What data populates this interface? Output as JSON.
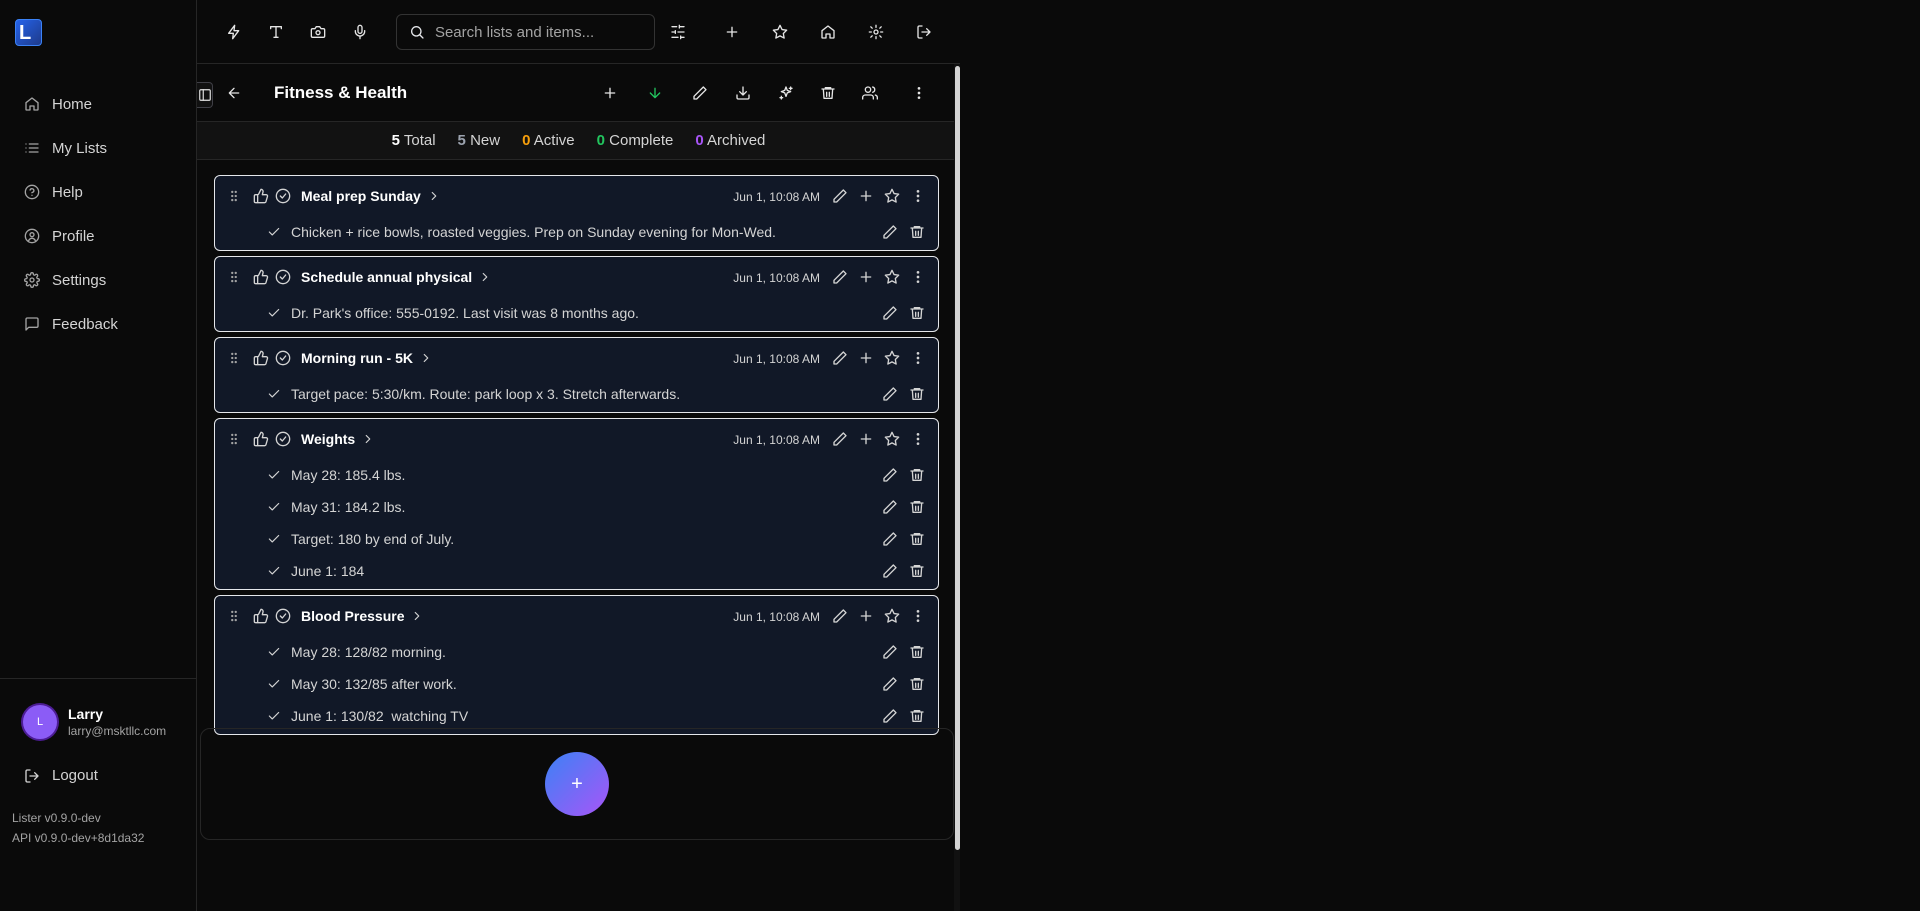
{
  "app": {
    "logo_letter": "L"
  },
  "sidebar": {
    "items": [
      {
        "label": "Home",
        "icon": "home-icon"
      },
      {
        "label": "My Lists",
        "icon": "list-icon"
      },
      {
        "label": "Help",
        "icon": "help-icon"
      },
      {
        "label": "Profile",
        "icon": "profile-icon"
      },
      {
        "label": "Settings",
        "icon": "gear-icon"
      },
      {
        "label": "Feedback",
        "icon": "message-icon"
      }
    ],
    "user": {
      "initial": "L",
      "name": "Larry",
      "email": "larry@msktllc.com"
    },
    "logout_label": "Logout",
    "version": "Lister v0.9.0-dev",
    "api_version": "API v0.9.0-dev+8d1da32"
  },
  "topbar": {
    "search_placeholder": "Search lists and items..."
  },
  "list": {
    "title": "Fitness & Health"
  },
  "stats": {
    "total": {
      "count": "5",
      "label": "Total",
      "color": "#ffffff"
    },
    "new": {
      "count": "5",
      "label": "New",
      "color": "#9ca3af"
    },
    "active": {
      "count": "0",
      "label": "Active",
      "color": "#f59e0b"
    },
    "complete": {
      "count": "0",
      "label": "Complete",
      "color": "#22c55e"
    },
    "archived": {
      "count": "0",
      "label": "Archived",
      "color": "#a855f7"
    }
  },
  "items": [
    {
      "title": "Meal prep Sunday",
      "timestamp": "Jun 1, 10:08 AM",
      "subitems": [
        "Chicken + rice bowls, roasted veggies. Prep on Sunday evening for Mon-Wed."
      ]
    },
    {
      "title": "Schedule annual physical",
      "timestamp": "Jun 1, 10:08 AM",
      "subitems": [
        "Dr. Park's office: 555-0192. Last visit was 8 months ago."
      ]
    },
    {
      "title": "Morning run - 5K",
      "timestamp": "Jun 1, 10:08 AM",
      "subitems": [
        "Target pace: 5:30/km. Route: park loop x 3. Stretch afterwards."
      ]
    },
    {
      "title": "Weights",
      "timestamp": "Jun 1, 10:08 AM",
      "subitems": [
        "May 28: 185.4 lbs.",
        "May 31: 184.2 lbs.",
        "Target: 180 by end of July.",
        "June 1: 184"
      ]
    },
    {
      "title": "Blood Pressure",
      "timestamp": "Jun 1, 10:08 AM",
      "subitems": [
        "May 28: 128/82 morning.",
        "May 30: 132/85 after work.",
        "June 1: 130/82  watching TV"
      ]
    }
  ],
  "fab_label": "+"
}
